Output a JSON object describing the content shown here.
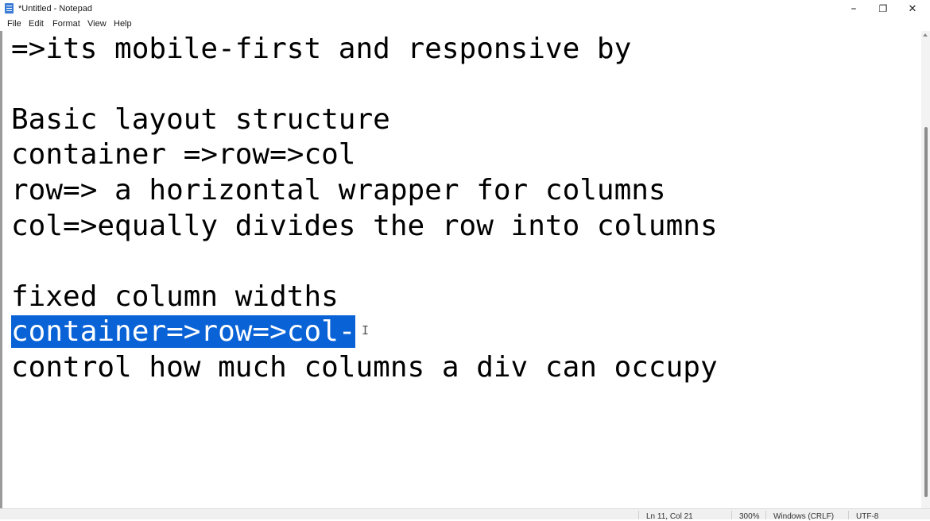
{
  "window": {
    "title": "*Untitled - Notepad",
    "minimize": "–",
    "maximize": "❐",
    "close": "✕"
  },
  "menu": [
    "File",
    "Edit",
    "Format",
    "View",
    "Help"
  ],
  "editor": {
    "lines": [
      "=>its mobile-first and responsive by",
      "",
      "Basic layout structure",
      "container =>row=>col",
      "row=> a horizontal wrapper for columns",
      "col=>equally divides the row into columns",
      "",
      "fixed column widths",
      "container=>row=>col-",
      "control how much columns a div can occupy"
    ],
    "selected_text": "container=>row=>col-",
    "cursor_glyph": "I"
  },
  "status": {
    "position": "Ln 11, Col 21",
    "zoom": "300%",
    "line_ending": "Windows (CRLF)",
    "encoding": "UTF-8"
  },
  "colors": {
    "selection": "#0a63d6"
  }
}
